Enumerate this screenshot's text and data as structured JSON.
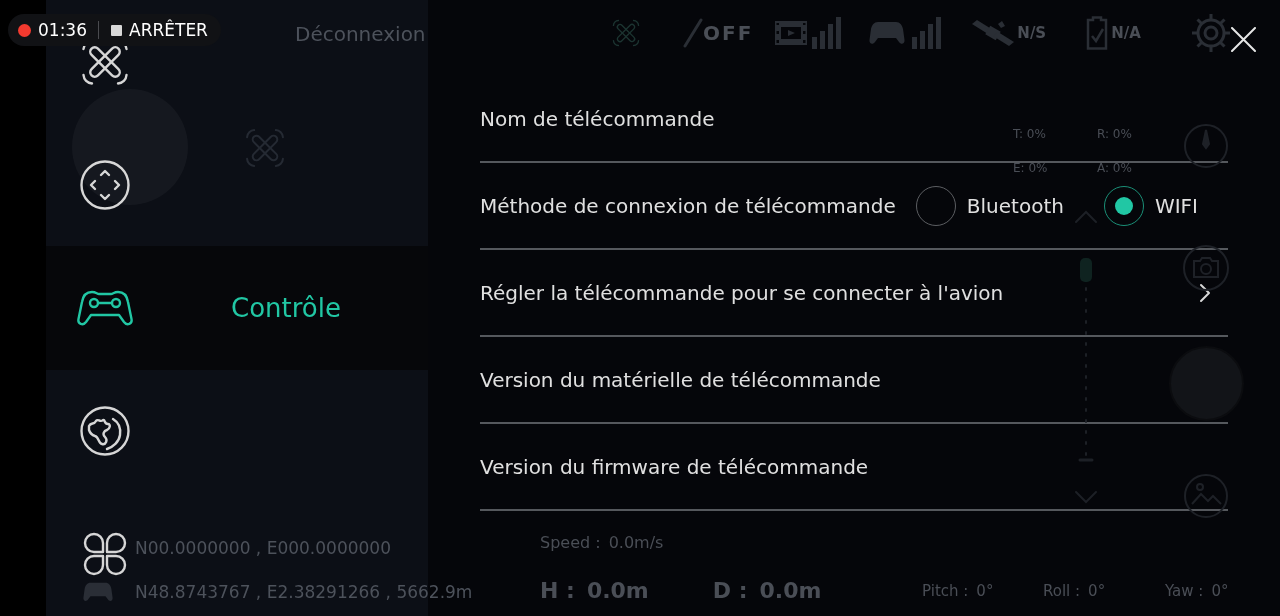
{
  "recording": {
    "time": "01:36",
    "stop": "ARRÊTER"
  },
  "hud": {
    "connection": "Déconnexion",
    "indicators": [
      {
        "kind": "drone"
      },
      {
        "kind": "obstacle",
        "text": "OFF"
      },
      {
        "kind": "video"
      },
      {
        "kind": "controller"
      },
      {
        "kind": "satellite",
        "text": "N/S"
      },
      {
        "kind": "battery",
        "text": "N/A"
      },
      {
        "kind": "settings"
      }
    ],
    "stick_values": [
      "T: 0%",
      "R: 0%",
      "E: 0%",
      "A: 0%"
    ],
    "coordinates": [
      {
        "kind": "aircraft",
        "text": "N00.0000000 , E000.0000000"
      },
      {
        "kind": "controller",
        "text": "N48.8743767 , E2.38291266 , 5662.9m"
      }
    ],
    "speed": {
      "label": "Speed :",
      "value": "0.0m/s"
    },
    "distances": [
      {
        "label": "H :",
        "value": "0.0m"
      },
      {
        "label": "D :",
        "value": "0.0m"
      }
    ],
    "attitude": [
      {
        "label": "Pitch :",
        "value": "0°"
      },
      {
        "label": "Roll :",
        "value": "0°"
      },
      {
        "label": "Yaw :",
        "value": "0°"
      }
    ]
  },
  "sidebar": {
    "items": [
      {
        "kind": "drone",
        "selected": false
      },
      {
        "kind": "dpad",
        "selected": false
      },
      {
        "kind": "controller",
        "label": "Contrôle",
        "selected": true
      },
      {
        "kind": "globe",
        "selected": false
      },
      {
        "kind": "quad",
        "selected": false
      }
    ]
  },
  "settings": {
    "rows": [
      {
        "kind": "plain",
        "label": "Nom de télécommande"
      },
      {
        "kind": "radio",
        "label": "Méthode de connexion de télécommande",
        "options": [
          {
            "label": "Bluetooth",
            "selected": false
          },
          {
            "label": "WIFI",
            "selected": true
          }
        ]
      },
      {
        "kind": "link",
        "label": "Régler la télécommande pour se connecter à l'avion"
      },
      {
        "kind": "plain",
        "label": "Version du matérielle de télécommande"
      },
      {
        "kind": "plain",
        "label": "Version du firmware de télécommande"
      }
    ]
  }
}
